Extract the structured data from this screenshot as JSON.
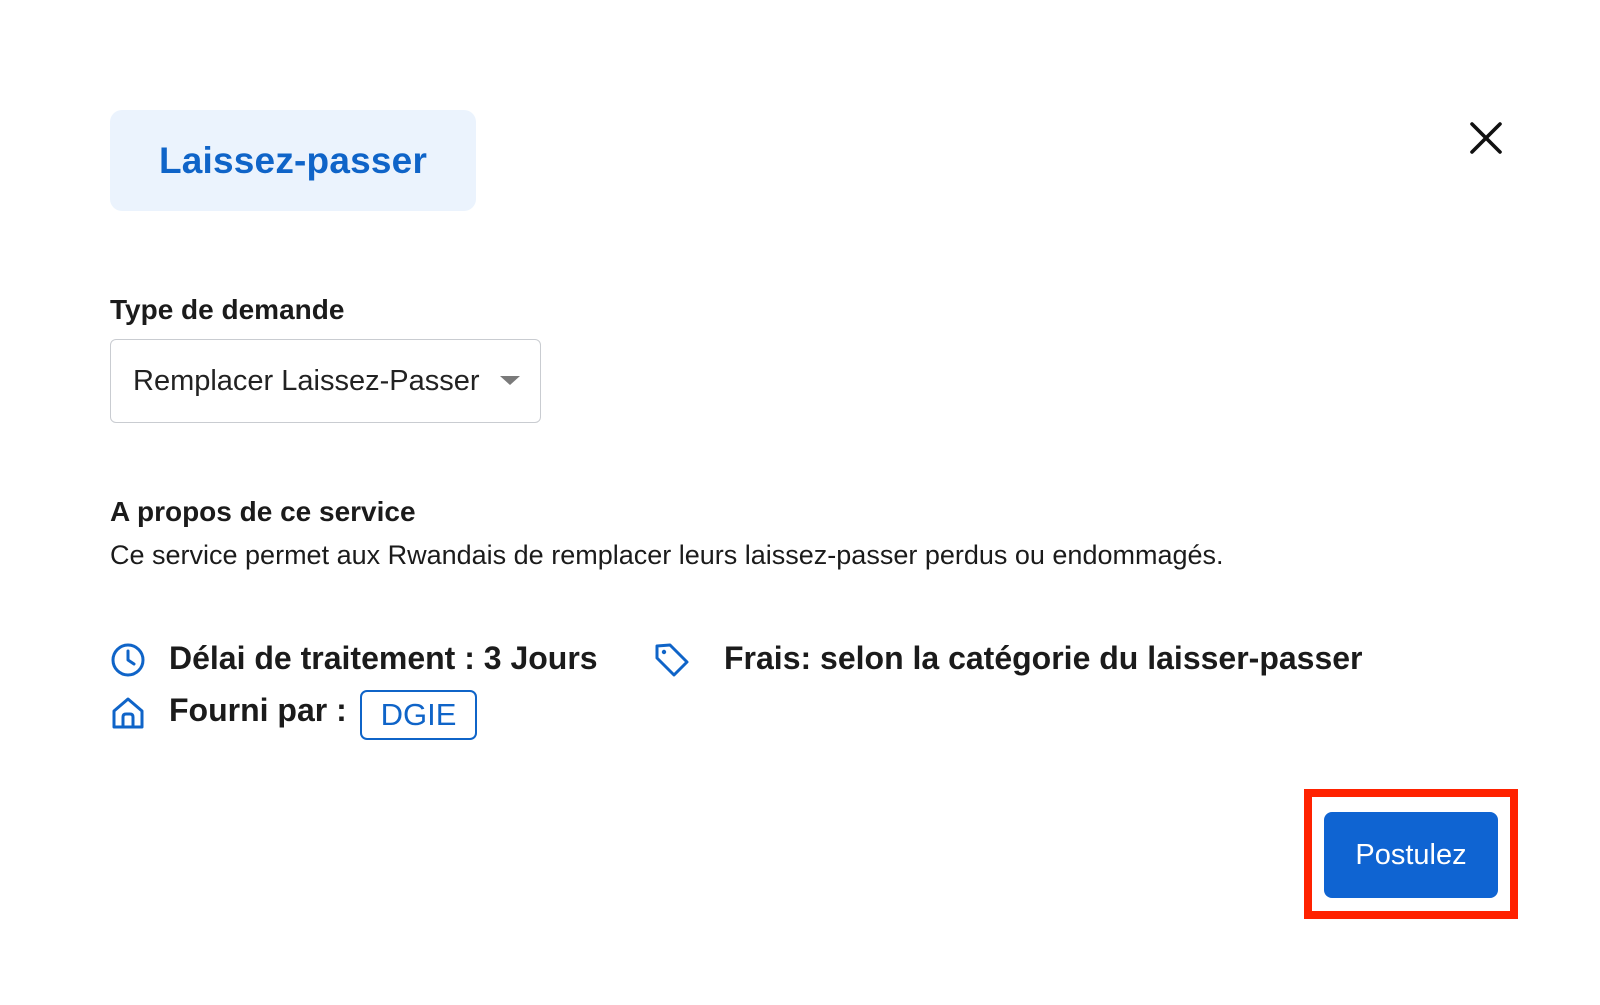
{
  "modal": {
    "title": "Laissez-passer",
    "close_icon": "close-icon"
  },
  "form": {
    "type_label": "Type de demande",
    "type_value": "Remplacer Laissez-Passer",
    "caret_icon": "caret-down-icon"
  },
  "about": {
    "heading": "A propos de ce service",
    "text": "Ce service permet aux Rwandais de remplacer leurs laissez-passer perdus ou endommagés."
  },
  "meta": {
    "processing_time": "Délai de traitement : 3 Jours",
    "fees": "Frais: selon la catégorie du laisser-passer",
    "provided_by_label": "Fourni par :",
    "provider": "DGIE",
    "icons": [
      "clock-icon",
      "tag-icon",
      "home-icon"
    ]
  },
  "actions": {
    "apply_label": "Postulez"
  },
  "colors": {
    "accent": "#0f64c8",
    "chip_bg": "#ebf3fd",
    "button_bg": "#0f64d2",
    "highlight": "#ff2200",
    "text": "#1b1b1b"
  }
}
